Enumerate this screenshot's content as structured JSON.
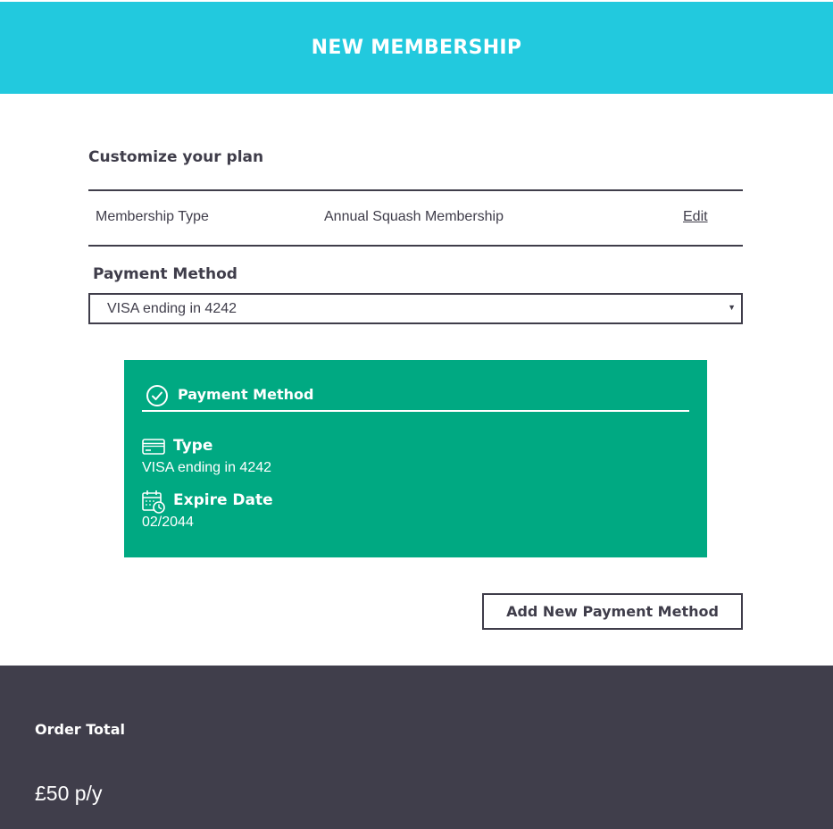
{
  "header": {
    "title": "NEW MEMBERSHIP"
  },
  "plan": {
    "section_title": "Customize your plan",
    "row": {
      "label": "Membership Type",
      "value": "Annual Squash Membership",
      "edit_label": "Edit"
    }
  },
  "payment": {
    "label": "Payment Method",
    "selected": "VISA ending in 4242"
  },
  "card": {
    "title": "Payment Method",
    "type_label": "Type",
    "type_value": "VISA ending in 4242",
    "expire_label": "Expire Date",
    "expire_value": "02/2044",
    "icons": [
      "check-circle-icon",
      "credit-card-icon",
      "calendar-clock-icon"
    ]
  },
  "add_button": {
    "label": "Add New Payment Method"
  },
  "footer": {
    "label": "Order Total",
    "price": "£50 p/y"
  },
  "colors": {
    "header": "#22c9de",
    "card": "#00a982",
    "footer": "#403e4b",
    "text": "#3f3d4a"
  }
}
